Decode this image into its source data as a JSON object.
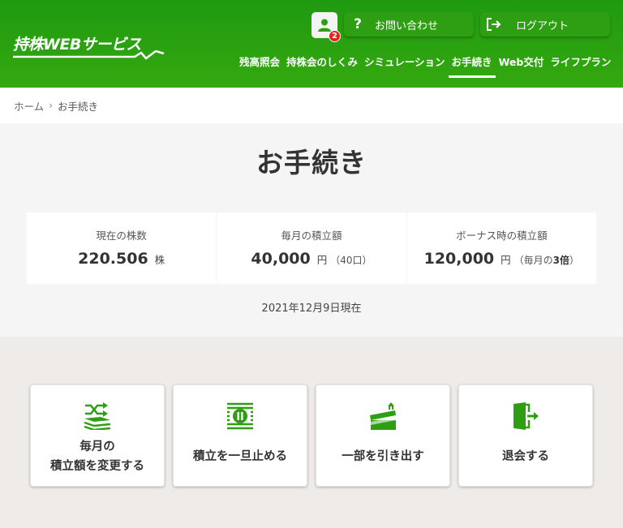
{
  "header": {
    "logo_text": "持株WEBサービス",
    "badge_count": "2",
    "contact_label": "お問い合わせ",
    "logout_label": "ログアウト",
    "nav": [
      {
        "label": "残高照会"
      },
      {
        "label": "持株会のしくみ"
      },
      {
        "label": "シミュレーション"
      },
      {
        "label": "お手続き",
        "active": true
      },
      {
        "label": "Web交付"
      },
      {
        "label": "ライフプラン"
      }
    ]
  },
  "breadcrumb": {
    "home": "ホーム",
    "separator": "›",
    "current": "お手続き"
  },
  "page": {
    "title": "お手続き",
    "as_of": "2021年12月9日現在"
  },
  "summary": {
    "shares": {
      "caption": "現在の株数",
      "value": "220.506",
      "unit": "株"
    },
    "monthly": {
      "caption": "毎月の積立額",
      "value": "40,000",
      "unit": "円",
      "note": "（40口）"
    },
    "bonus": {
      "caption": "ボーナス時の積立額",
      "value": "120,000",
      "unit": "円",
      "note_prefix": "（毎月の",
      "note_bold": "3倍",
      "note_suffix": "）"
    }
  },
  "actions": [
    {
      "line1": "毎月の",
      "line2": "積立額を変更する",
      "icon": "change-amount-icon"
    },
    {
      "line1": "積立を一旦止める",
      "icon": "pause-icon"
    },
    {
      "line1": "一部を引き出す",
      "icon": "withdraw-icon"
    },
    {
      "line1": "退会する",
      "icon": "exit-door-icon"
    }
  ],
  "colors": {
    "brand_green": "#2e9f12",
    "badge_red": "#e0231c",
    "icon_green": "#2e9f12"
  }
}
